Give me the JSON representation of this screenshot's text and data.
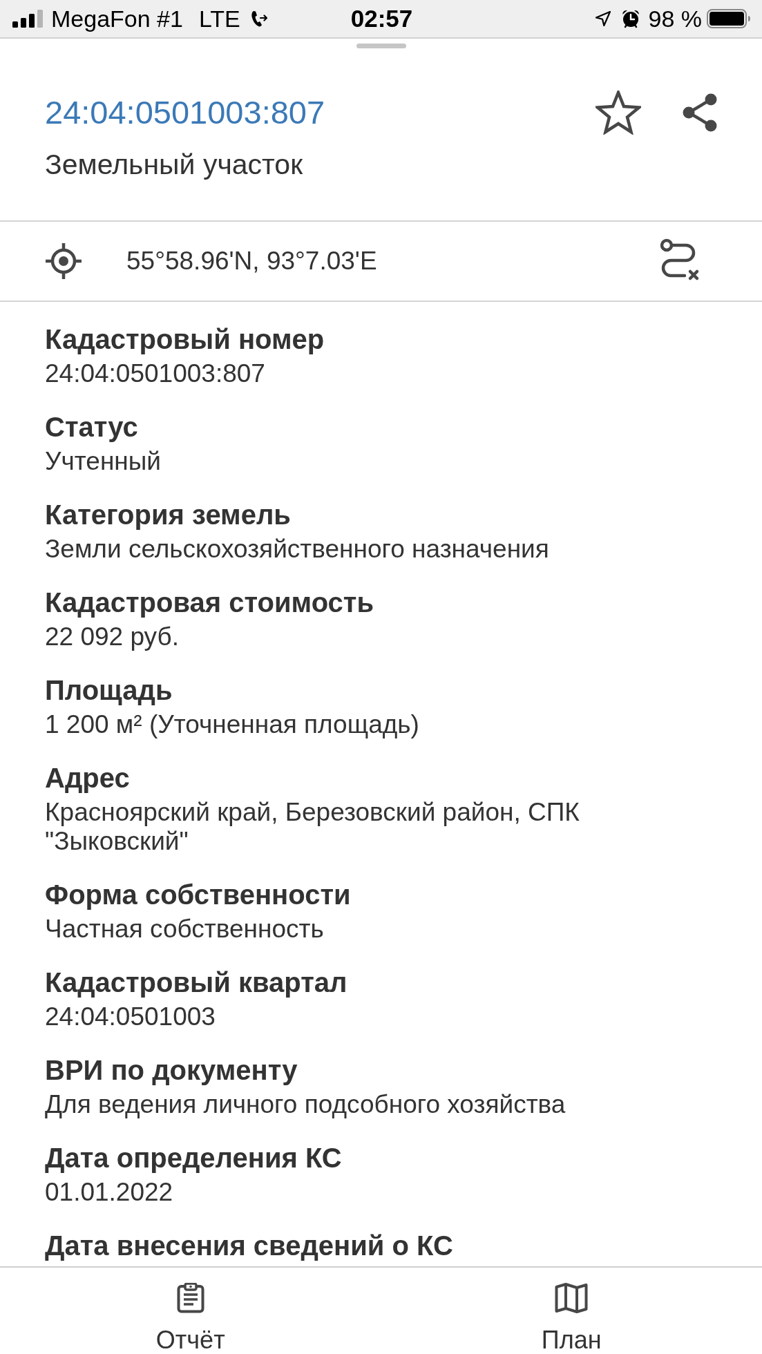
{
  "status_bar": {
    "carrier": "MegaFon #1",
    "network": "LTE",
    "time": "02:57",
    "battery_percent": "98 %"
  },
  "header": {
    "title": "24:04:0501003:807",
    "subtitle": "Земельный участок",
    "starred": false
  },
  "location": {
    "coordinates": "55°58.96'N, 93°7.03'E"
  },
  "fields": [
    {
      "label": "Кадастровый номер",
      "value": "24:04:0501003:807"
    },
    {
      "label": "Статус",
      "value": "Учтенный"
    },
    {
      "label": "Категория земель",
      "value": "Земли сельскохозяйственного назначения"
    },
    {
      "label": "Кадастровая стоимость",
      "value": "22 092 руб."
    },
    {
      "label": "Площадь",
      "value": "1 200 м² (Уточненная площадь)"
    },
    {
      "label": "Адрес",
      "value": "Красноярский край, Березовский район, СПК \"Зыковский\""
    },
    {
      "label": "Форма собственности",
      "value": "Частная собственность"
    },
    {
      "label": "Кадастровый квартал",
      "value": "24:04:0501003"
    },
    {
      "label": "ВРИ по документу",
      "value": "Для ведения личного подсобного хозяйства"
    },
    {
      "label": "Дата определения КС",
      "value": "01.01.2022"
    },
    {
      "label": "Дата внесения сведений о КС"
    }
  ],
  "bottom_tabs": [
    {
      "kind": "report",
      "label": "Отчёт"
    },
    {
      "kind": "map",
      "label": "План"
    }
  ]
}
